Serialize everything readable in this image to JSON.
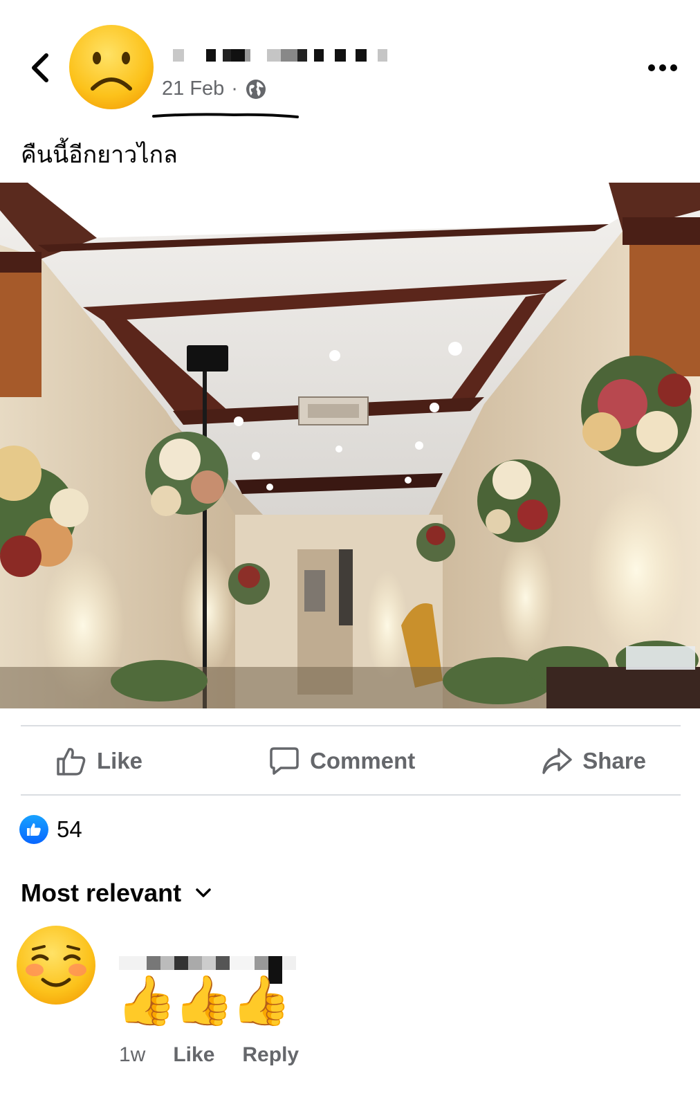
{
  "post": {
    "author_name_redacted": "",
    "date": "21 Feb",
    "separator": "·",
    "audience_icon": "globe-icon",
    "caption": "คืนนี้อีกยาวไกล",
    "photo_alt": "Decorated wedding hall with flowers and lighting"
  },
  "actions": {
    "like": "Like",
    "comment": "Comment",
    "share": "Share"
  },
  "reactions": {
    "icon": "like-reaction-icon",
    "count": "54"
  },
  "comments": {
    "sort_label": "Most relevant",
    "items": [
      {
        "author_name_redacted": "",
        "text": "👍👍👍",
        "time": "1w",
        "like_label": "Like",
        "reply_label": "Reply"
      }
    ]
  },
  "colors": {
    "secondary_text": "#65676b",
    "primary_text": "#050505",
    "divider": "#dadde1",
    "like_blue": "#0866ff"
  }
}
